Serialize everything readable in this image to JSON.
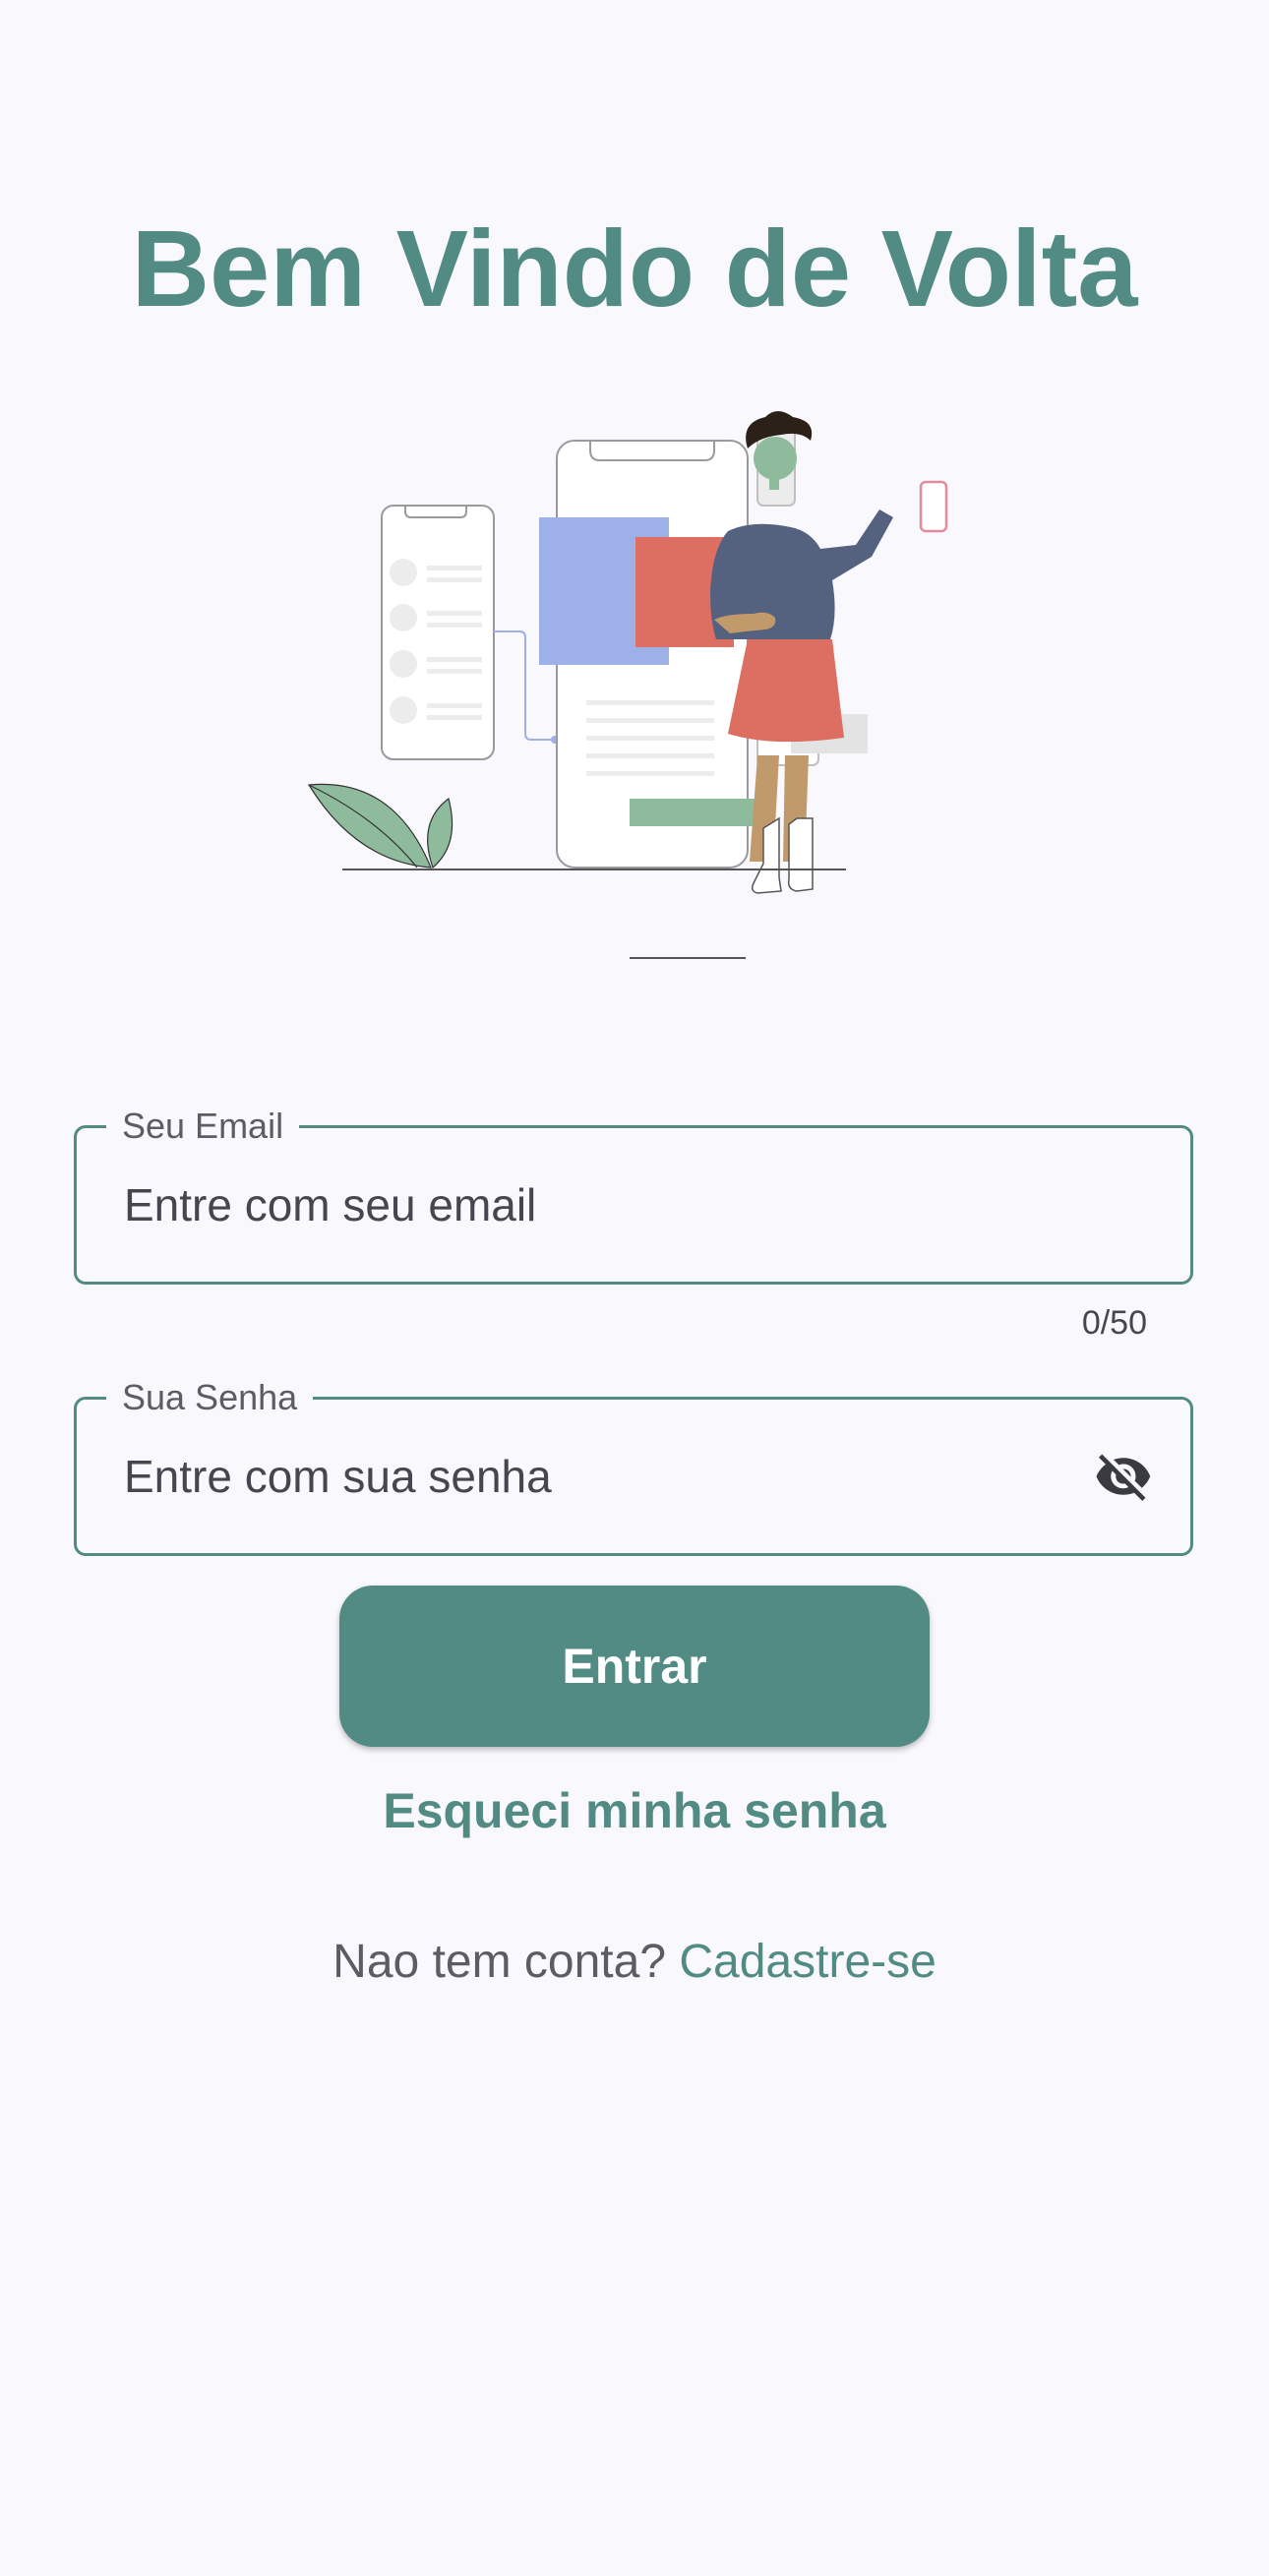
{
  "header": {
    "title": "Bem Vindo de Volta"
  },
  "illustration": {
    "name": "person-with-phone-screens-illustration"
  },
  "email": {
    "label": "Seu Email",
    "placeholder": "Entre com seu email",
    "value": "",
    "counter": "0/50"
  },
  "password": {
    "label": "Sua Senha",
    "placeholder": "Entre com sua senha",
    "value": "",
    "toggle_icon": "visibility-off-icon"
  },
  "actions": {
    "login_label": "Entrar",
    "forgot_label": "Esqueci minha senha"
  },
  "signup": {
    "prompt": "Nao tem conta?",
    "link": "Cadastre-se"
  },
  "colors": {
    "accent": "#528a84",
    "background": "#f9f8fd",
    "text": "#45464f"
  }
}
